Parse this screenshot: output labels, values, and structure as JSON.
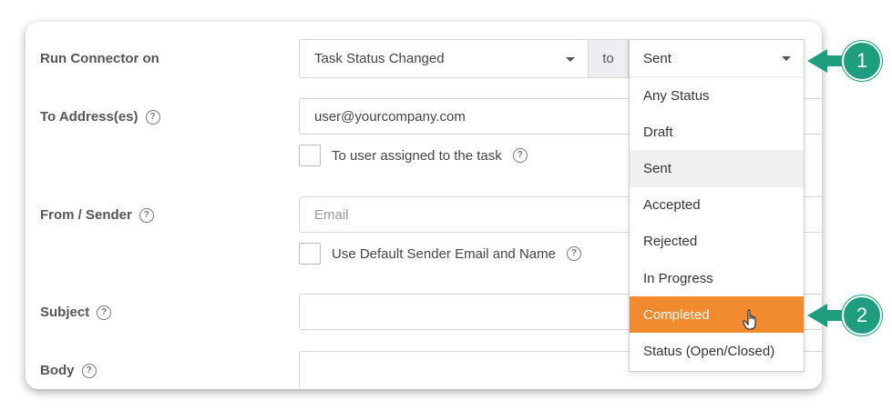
{
  "form": {
    "run_connector": {
      "label": "Run Connector on",
      "event_value": "Task Status Changed",
      "to_label": "to",
      "status_value": "Sent"
    },
    "to_address": {
      "label": "To Address(es)",
      "value": "user@yourcompany.com",
      "checkbox_label": "To user assigned to the task"
    },
    "from_sender": {
      "label": "From / Sender",
      "placeholder": "Email",
      "checkbox_label": "Use Default Sender Email and Name"
    },
    "subject": {
      "label": "Subject",
      "value": ""
    },
    "body": {
      "label": "Body",
      "value": ""
    },
    "help_glyph": "?"
  },
  "dropdown": {
    "selected": "Sent",
    "options": [
      "Any Status",
      "Draft",
      "Sent",
      "Accepted",
      "Rejected",
      "In Progress",
      "Completed",
      "Status (Open/Closed)"
    ],
    "hovered_option": "Sent",
    "highlighted_option": "Completed"
  },
  "callouts": [
    {
      "number": "1"
    },
    {
      "number": "2"
    }
  ],
  "colors": {
    "accent": "#f28a30",
    "callout": "#1f9e7f"
  }
}
